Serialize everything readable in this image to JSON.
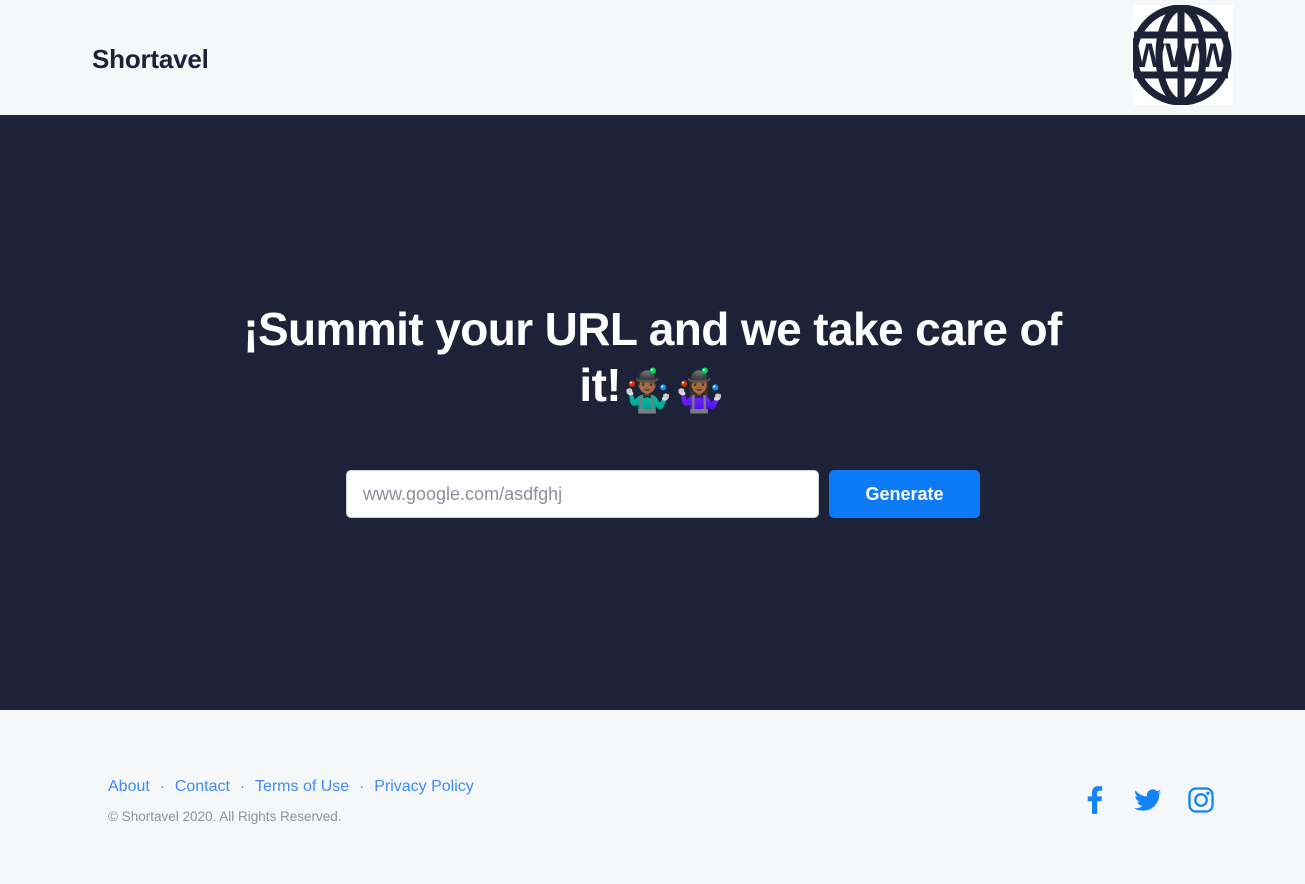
{
  "header": {
    "brand": "Shortavel",
    "logo_alt": "www-globe-logo",
    "logo_text": "WWW"
  },
  "hero": {
    "headline_line1": "¡Summit your URL and we take care of",
    "headline_line2": "it!",
    "emoji": "🤹🏾‍♂️🤹🏾‍♀️",
    "background_color": "#1e2239"
  },
  "form": {
    "input_value": "",
    "input_placeholder": "www.google.com/asdfghj",
    "submit_label": "Generate",
    "accent_color": "#0d7bf7"
  },
  "footer": {
    "links": [
      {
        "label": "About"
      },
      {
        "label": "Contact"
      },
      {
        "label": "Terms of Use"
      },
      {
        "label": "Privacy Policy"
      }
    ],
    "separator": "·",
    "copyright": "© Shortavel 2020. All Rights Reserved.",
    "link_color": "#3d8bfd",
    "social": [
      {
        "name": "facebook-icon"
      },
      {
        "name": "twitter-icon"
      },
      {
        "name": "instagram-icon"
      }
    ]
  }
}
